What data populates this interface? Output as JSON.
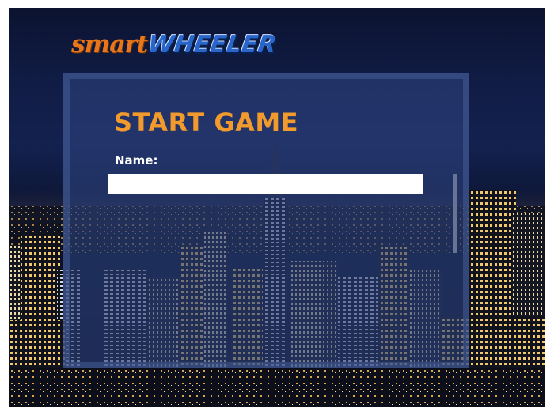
{
  "logo": {
    "smart": "smart",
    "wheeler": "WHEELER",
    "colors": {
      "smart": "#e8771c",
      "wheeler": "#2a66c9"
    }
  },
  "start_panel": {
    "title": "START GAME",
    "name_label": "Name:",
    "name_value": "",
    "name_placeholder": ""
  },
  "colors": {
    "title": "#f29a2b",
    "label": "#ffffff",
    "panel": "#2c407a",
    "background": "#0b1330"
  }
}
